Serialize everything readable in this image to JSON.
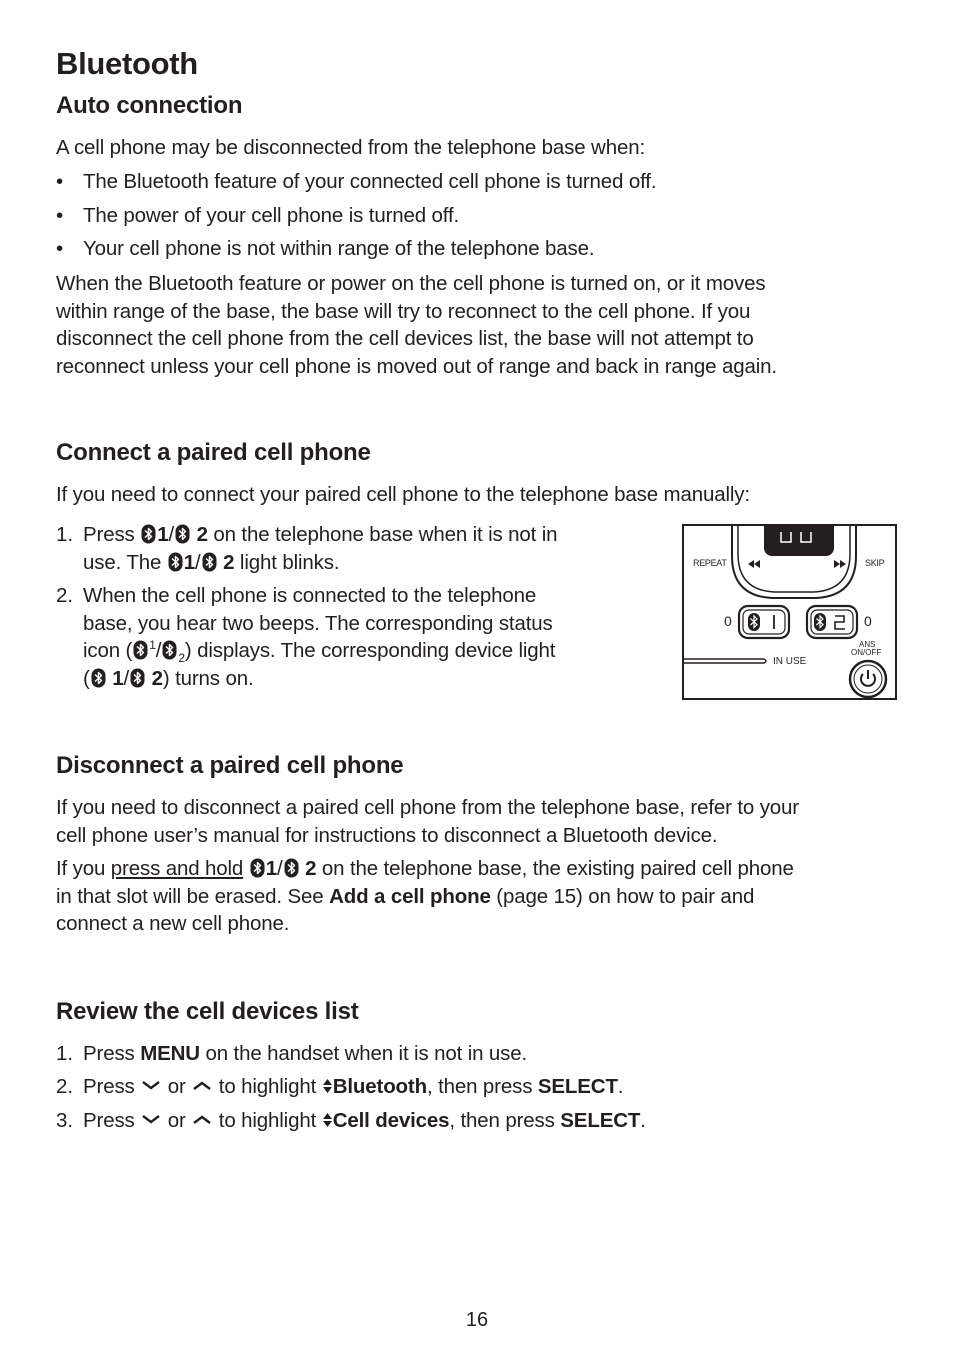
{
  "page": {
    "title": "Bluetooth",
    "page_number": "16"
  },
  "auto_connection": {
    "heading": "Auto connection",
    "intro": "A cell phone may be disconnected from the telephone base when:",
    "bullets": [
      "The Bluetooth feature of your connected cell phone is turned off.",
      "The power of your cell phone is turned off.",
      "Your cell phone is not within range of the telephone base."
    ],
    "paragraph_lines": [
      "When the Bluetooth feature or power on the cell phone is turned on, or it moves",
      "within range of the base, the base will try to reconnect to the cell phone. If you",
      "disconnect the cell phone from the cell devices list, the base will not attempt to",
      "reconnect unless your cell phone is moved out of range and back in range again."
    ]
  },
  "connect": {
    "heading": "Connect a paired cell phone",
    "intro": "If you need to connect your paired cell phone to the telephone base manually:",
    "step1": {
      "num": "1.",
      "press": "Press",
      "k1": "1",
      "slash": "/",
      "k2": "2",
      "rest1": " on the telephone base when it is not in",
      "line2a": "use. The",
      "rest2": " light blinks."
    },
    "step2": {
      "num": "2.",
      "line1": "When the cell phone is connected to the telephone",
      "line2": "base, you hear two beeps. The corresponding status",
      "line3a": "icon (",
      "sup": "1",
      "sub": "2",
      "line3b": ") displays. The corresponding device light",
      "line4a": "(",
      "line4b": ") turns on."
    }
  },
  "diagram": {
    "repeat": "REPEAT",
    "skip": "SKIP",
    "left_count": "0",
    "right_count": "0",
    "button1": "1",
    "button2": "2",
    "ans": "ANS",
    "onoff": "ON/OFF",
    "in_use": "IN USE"
  },
  "disconnect": {
    "heading": "Disconnect a paired cell phone",
    "para1_lines": [
      "If you need to disconnect a paired cell phone from the telephone base, refer to your",
      "cell phone user’s manual for instructions to disconnect a Bluetooth device."
    ],
    "para2": {
      "a": "If you ",
      "link": "press and hold",
      "b": " on the telephone base, the existing paired cell phone",
      "c": "in that slot will be erased. See ",
      "bold": "Add a cell phone",
      "d": " (page 15) on how to pair and",
      "e": "connect a new cell phone."
    }
  },
  "review": {
    "heading": "Review the cell devices list",
    "step1": {
      "num": "1.",
      "a": "Press ",
      "bold": "MENU",
      "b": " on the handset when it is not in use."
    },
    "step2": {
      "num": "2.",
      "a": "Press ",
      "or": " or ",
      "c": " to highlight ",
      "bold1": "Bluetooth",
      "d": ", then press ",
      "bold2": "SELECT",
      "e": "."
    },
    "step3": {
      "num": "3.",
      "a": "Press ",
      "or": " or ",
      "c": " to highlight ",
      "bold1": "Cell devices",
      "d": ", then press ",
      "bold2": "SELECT",
      "e": "."
    }
  }
}
